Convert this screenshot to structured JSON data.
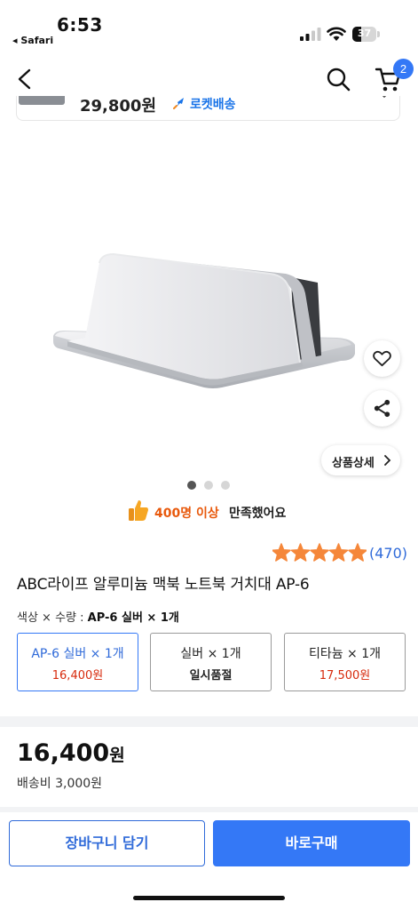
{
  "status_bar": {
    "time": "6:53",
    "back_app": "◂ Safari",
    "battery_percent": "37",
    "battery_level": 0.37
  },
  "nav": {
    "cart_count": "2"
  },
  "compare_card": {
    "price": "29,800원",
    "delivery_label": "로켓배송"
  },
  "carousel": {
    "total_images": 3,
    "active_index": 0,
    "detail_button_label": "상품상세"
  },
  "satisfaction": {
    "highlight": "400명 이상",
    "rest": "만족했어요"
  },
  "rating": {
    "stars": 5,
    "review_count": "(470)"
  },
  "product": {
    "title": "ABC라이프 알루미늄 맥북 노트북 거치대 AP-6"
  },
  "options": {
    "label_prefix": "색상 × 수량 : ",
    "label_value": "AP-6 실버 × 1개",
    "items": [
      {
        "name": "AP-6 실버 × 1개",
        "price": "16,400원",
        "selected": true
      },
      {
        "name": "실버 × 1개",
        "status": "일시품절",
        "selected": false
      },
      {
        "name": "티타늄 × 1개",
        "price": "17,500원",
        "selected": false
      }
    ]
  },
  "summary": {
    "price_number": "16,400",
    "price_unit": "원",
    "shipping": "배송비 3,000원"
  },
  "actions": {
    "add_to_cart": "장바구니 담기",
    "buy_now": "바로구매"
  },
  "colors": {
    "accent": "#3478f6",
    "price_red": "#d72a0c",
    "highlight_orange": "#e8590c",
    "star": "#f5873a"
  },
  "icons": [
    "chevron-left-icon",
    "search-icon",
    "cart-icon",
    "rocket-icon",
    "heart-icon",
    "share-icon",
    "chevron-right-icon",
    "thumbs-up-icon",
    "star-icon"
  ]
}
